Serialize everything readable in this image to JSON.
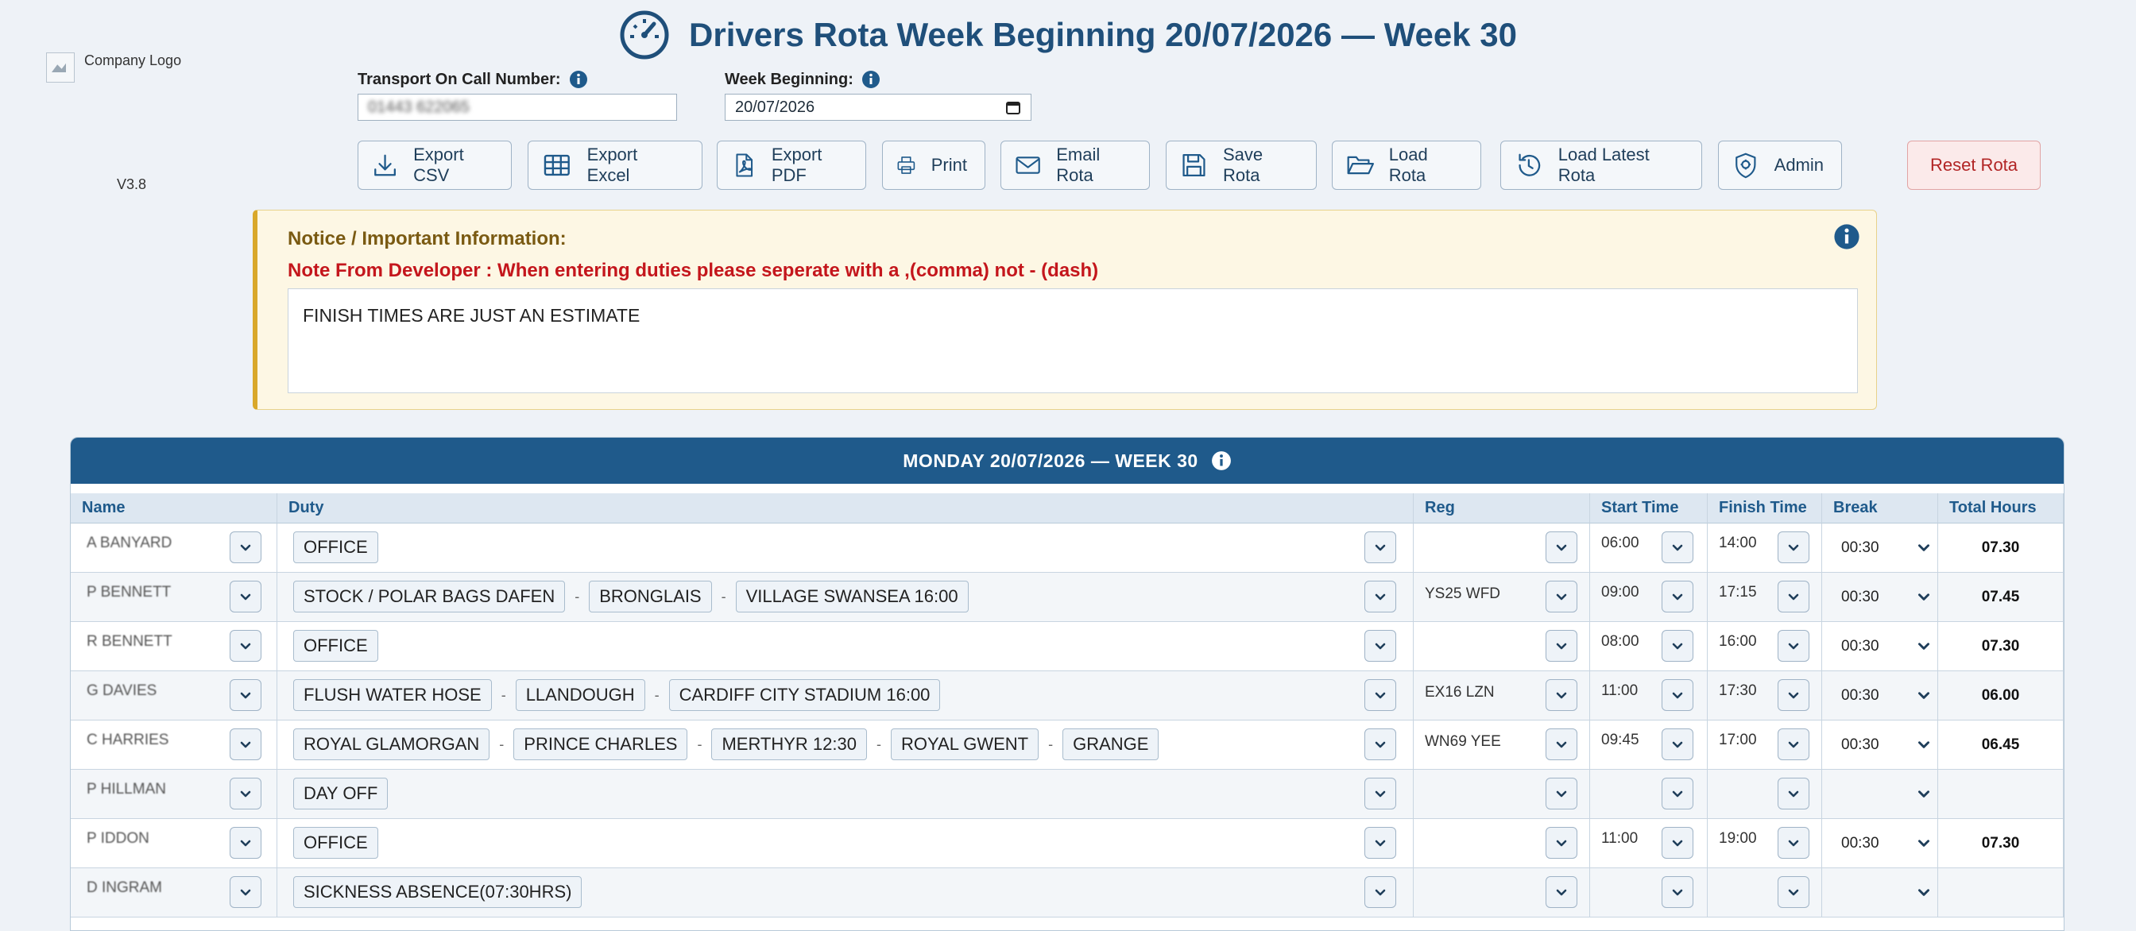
{
  "header": {
    "title": "Drivers Rota Week Beginning 20/07/2026 — Week 30",
    "logo_alt": "Company Logo",
    "version": "V3.8"
  },
  "fields": {
    "on_call_label": "Transport On Call Number:",
    "on_call_value": "01443 622065",
    "week_label": "Week Beginning:",
    "week_value": "20/07/2026"
  },
  "toolbar": [
    {
      "label": "Export CSV",
      "icon": "download-icon"
    },
    {
      "label": "Export Excel",
      "icon": "table-icon"
    },
    {
      "label": "Export PDF",
      "icon": "pdf-file-icon"
    },
    {
      "label": "Print",
      "icon": "printer-icon"
    },
    {
      "label": "Email Rota",
      "icon": "envelope-icon"
    },
    {
      "label": "Save Rota",
      "icon": "floppy-icon"
    },
    {
      "label": "Load Rota",
      "icon": "folder-open-icon"
    },
    {
      "label": "Load Latest Rota",
      "icon": "history-icon"
    },
    {
      "label": "Admin",
      "icon": "shield-icon"
    },
    {
      "label": "Reset Rota",
      "icon": ""
    }
  ],
  "notice": {
    "title": "Notice / Important Information:",
    "developer_note": "Note From Developer : When entering duties please seperate with a ,(comma) not - (dash)",
    "text": "FINISH TIMES ARE JUST AN ESTIMATE"
  },
  "day": {
    "header": "MONDAY 20/07/2026 — WEEK 30",
    "columns": [
      "Name",
      "Duty",
      "Reg",
      "Start Time",
      "Finish Time",
      "Break",
      "Total Hours"
    ],
    "rows": [
      {
        "name": "A BANYARD",
        "duties": [
          "OFFICE"
        ],
        "reg": "",
        "start": "06:00",
        "finish": "14:00",
        "break": "00:30",
        "total": "07.30"
      },
      {
        "name": "P BENNETT",
        "duties": [
          "STOCK / POLAR BAGS DAFEN",
          "BRONGLAIS",
          "VILLAGE SWANSEA 16:00"
        ],
        "reg": "YS25 WFD",
        "start": "09:00",
        "finish": "17:15",
        "break": "00:30",
        "total": "07.45"
      },
      {
        "name": "R BENNETT",
        "duties": [
          "OFFICE"
        ],
        "reg": "",
        "start": "08:00",
        "finish": "16:00",
        "break": "00:30",
        "total": "07.30"
      },
      {
        "name": "G DAVIES",
        "duties": [
          "FLUSH WATER HOSE",
          "LLANDOUGH",
          "CARDIFF CITY STADIUM 16:00"
        ],
        "reg": "EX16 LZN",
        "start": "11:00",
        "finish": "17:30",
        "break": "00:30",
        "total": "06.00"
      },
      {
        "name": "C HARRIES",
        "duties": [
          "ROYAL GLAMORGAN",
          "PRINCE CHARLES",
          "MERTHYR 12:30",
          "ROYAL GWENT",
          "GRANGE"
        ],
        "reg": "WN69 YEE",
        "start": "09:45",
        "finish": "17:00",
        "break": "00:30",
        "total": "06.45"
      },
      {
        "name": "P HILLMAN",
        "duties": [
          "DAY OFF"
        ],
        "reg": "",
        "start": "",
        "finish": "",
        "break": "",
        "total": ""
      },
      {
        "name": "P IDDON",
        "duties": [
          "OFFICE"
        ],
        "reg": "",
        "start": "11:00",
        "finish": "19:00",
        "break": "00:30",
        "total": "07.30"
      },
      {
        "name": "D INGRAM",
        "duties": [
          "SICKNESS ABSENCE(07:30HRS)"
        ],
        "reg": "",
        "start": "",
        "finish": "",
        "break": "",
        "total": ""
      }
    ]
  },
  "colors": {
    "primary": "#1f5a8b",
    "title": "#1f4f7a",
    "danger": "#c4161c",
    "notice_bg": "#fdf7e4"
  }
}
